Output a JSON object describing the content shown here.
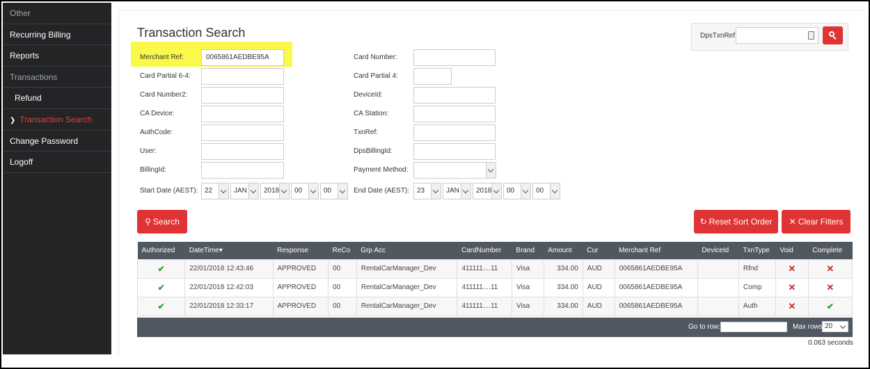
{
  "sidebar": {
    "items": [
      {
        "label": "Other"
      },
      {
        "label": "Recurring Billing"
      },
      {
        "label": "Reports"
      },
      {
        "label": "Transactions"
      },
      {
        "label": "Refund"
      },
      {
        "label": "Transaction Search"
      },
      {
        "label": "Change Password"
      },
      {
        "label": "Logoff"
      }
    ]
  },
  "page": {
    "title": "Transaction Search"
  },
  "dps": {
    "label": "DpsTxnRef:",
    "value": ""
  },
  "form": {
    "merchant_ref": {
      "label": "Merchant Ref:",
      "value": "0065861AEDBE95A"
    },
    "card_partial_6_4": {
      "label": "Card Partial 6-4:",
      "value": ""
    },
    "card_number2": {
      "label": "Card Number2:",
      "value": ""
    },
    "ca_device": {
      "label": "CA Device:",
      "value": ""
    },
    "auth_code": {
      "label": "AuthCode:",
      "value": ""
    },
    "user": {
      "label": "User:",
      "value": ""
    },
    "billing_id": {
      "label": "BillingId:",
      "value": ""
    },
    "card_number": {
      "label": "Card Number:",
      "value": ""
    },
    "card_partial_4": {
      "label": "Card Partial 4:",
      "value": ""
    },
    "device_id": {
      "label": "DeviceId:",
      "value": ""
    },
    "ca_station": {
      "label": "CA Station:",
      "value": ""
    },
    "txn_ref": {
      "label": "TxnRef:",
      "value": ""
    },
    "dps_billing_id": {
      "label": "DpsBillingId:",
      "value": ""
    },
    "payment_method": {
      "label": "Payment Method:",
      "value": ""
    },
    "start_date": {
      "label": "Start Date (AEST):",
      "day": "22",
      "month": "JAN",
      "year": "2018",
      "hour": "00",
      "minute": "00"
    },
    "end_date": {
      "label": "End Date (AEST):",
      "day": "23",
      "month": "JAN",
      "year": "2018",
      "hour": "00",
      "minute": "00"
    }
  },
  "buttons": {
    "search": "Search",
    "reset_sort": "Reset Sort Order",
    "clear_filters": "Clear Filters"
  },
  "table": {
    "headers": [
      "Authorized",
      "DateTime",
      "Response",
      "ReCo",
      "Grp Acc",
      "CardNumber",
      "Brand",
      "Amount",
      "Cur",
      "Merchant Ref",
      "DeviceId",
      "TxnType",
      "Void",
      "Complete"
    ],
    "sort_indicator": "▾",
    "rows": [
      {
        "authorized": "✔",
        "datetime": "22/01/2018 12:43:46",
        "response": "APPROVED",
        "reco": "00",
        "grp_acc": "RentalCarManager_Dev",
        "card_number": "411111....11",
        "brand": "Visa",
        "amount": "334.00",
        "cur": "AUD",
        "merchant_ref": "0065861AEDBE95A",
        "device_id": "",
        "txn_type": "Rfnd",
        "void": "✕",
        "complete": "✕"
      },
      {
        "authorized": "✔",
        "datetime": "22/01/2018 12:42:03",
        "response": "APPROVED",
        "reco": "00",
        "grp_acc": "RentalCarManager_Dev",
        "card_number": "411111....11",
        "brand": "Visa",
        "amount": "334.00",
        "cur": "AUD",
        "merchant_ref": "0065861AEDBE95A",
        "device_id": "",
        "txn_type": "Comp",
        "void": "✕",
        "complete": "✕"
      },
      {
        "authorized": "✔",
        "datetime": "22/01/2018 12:33:17",
        "response": "APPROVED",
        "reco": "00",
        "grp_acc": "RentalCarManager_Dev",
        "card_number": "411111....11",
        "brand": "Visa",
        "amount": "334.00",
        "cur": "AUD",
        "merchant_ref": "0065861AEDBE95A",
        "device_id": "",
        "txn_type": "Auth",
        "void": "✕",
        "complete": "✔"
      }
    ],
    "footer": {
      "goto_label": "Go to row:",
      "goto_value": "",
      "maxrows_label": "Max rows",
      "maxrows_value": "20"
    }
  },
  "timing": "0.063 seconds",
  "colors": {
    "accent": "#e03333",
    "sidebar_bg": "#222426",
    "table_header": "#515862",
    "highlight": "#faf84a",
    "active_nav": "#e04343"
  },
  "icons": {
    "search": "search-icon",
    "reset": "refresh-icon",
    "clear": "times-icon",
    "chevron": "chevron-down-icon",
    "keyboard": "keyboard-icon"
  }
}
